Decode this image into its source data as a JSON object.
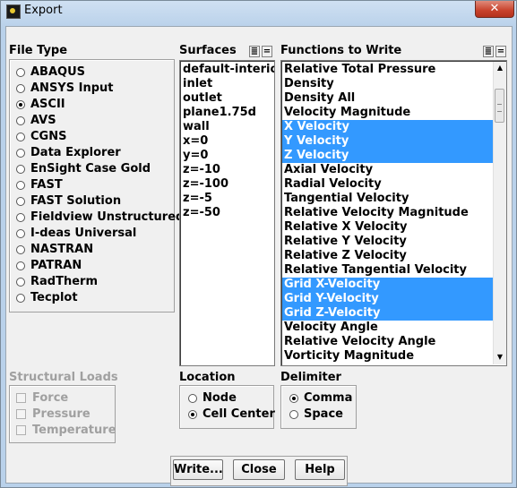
{
  "window": {
    "title": "Export",
    "close_glyph": "✕"
  },
  "file_type": {
    "label": "File Type",
    "options": [
      {
        "label": "ABAQUS",
        "selected": false
      },
      {
        "label": "ANSYS Input",
        "selected": false
      },
      {
        "label": "ASCII",
        "selected": true
      },
      {
        "label": "AVS",
        "selected": false
      },
      {
        "label": "CGNS",
        "selected": false
      },
      {
        "label": "Data Explorer",
        "selected": false
      },
      {
        "label": "EnSight Case Gold",
        "selected": false
      },
      {
        "label": "FAST",
        "selected": false
      },
      {
        "label": "FAST Solution",
        "selected": false
      },
      {
        "label": "Fieldview Unstructured",
        "selected": false
      },
      {
        "label": "I-deas Universal",
        "selected": false
      },
      {
        "label": "NASTRAN",
        "selected": false
      },
      {
        "label": "PATRAN",
        "selected": false
      },
      {
        "label": "RadTherm",
        "selected": false
      },
      {
        "label": "Tecplot",
        "selected": false
      }
    ]
  },
  "surfaces": {
    "label": "Surfaces",
    "items": [
      "default-interior",
      "inlet",
      "outlet",
      "plane1.75d",
      "wall",
      "x=0",
      "y=0",
      "z=-10",
      "z=-100",
      "z=-5",
      "z=-50"
    ]
  },
  "functions": {
    "label": "Functions to Write",
    "items": [
      {
        "label": "Relative Total Pressure",
        "selected": false
      },
      {
        "label": "Density",
        "selected": false
      },
      {
        "label": "Density All",
        "selected": false
      },
      {
        "label": "Velocity Magnitude",
        "selected": false
      },
      {
        "label": "X Velocity",
        "selected": true
      },
      {
        "label": "Y Velocity",
        "selected": true
      },
      {
        "label": "Z Velocity",
        "selected": true
      },
      {
        "label": "Axial Velocity",
        "selected": false
      },
      {
        "label": "Radial Velocity",
        "selected": false
      },
      {
        "label": "Tangential Velocity",
        "selected": false
      },
      {
        "label": "Relative Velocity Magnitude",
        "selected": false
      },
      {
        "label": "Relative X Velocity",
        "selected": false
      },
      {
        "label": "Relative Y Velocity",
        "selected": false
      },
      {
        "label": "Relative Z Velocity",
        "selected": false
      },
      {
        "label": "Relative Tangential Velocity",
        "selected": false
      },
      {
        "label": "Grid X-Velocity",
        "selected": true
      },
      {
        "label": "Grid Y-Velocity",
        "selected": true
      },
      {
        "label": "Grid Z-Velocity",
        "selected": true
      },
      {
        "label": "Velocity Angle",
        "selected": false
      },
      {
        "label": "Relative Velocity Angle",
        "selected": false
      },
      {
        "label": "Vorticity Magnitude",
        "selected": false
      }
    ]
  },
  "list_tool_icons": {
    "select_all": "≣",
    "deselect_all": "="
  },
  "structural_loads": {
    "label": "Structural Loads",
    "options": [
      "Force",
      "Pressure",
      "Temperature"
    ]
  },
  "location": {
    "label": "Location",
    "options": [
      {
        "label": "Node",
        "selected": false
      },
      {
        "label": "Cell Center",
        "selected": true
      }
    ]
  },
  "delimiter": {
    "label": "Delimiter",
    "options": [
      {
        "label": "Comma",
        "selected": true
      },
      {
        "label": "Space",
        "selected": false
      }
    ]
  },
  "buttons": {
    "write": "Write...",
    "close": "Close",
    "help": "Help"
  },
  "icons": {
    "app": "fluent-app-icon",
    "close": "close-icon",
    "select_all": "select-all-icon",
    "deselect_all": "deselect-all-icon",
    "scroll_up": "scroll-up-arrow-icon",
    "scroll_down": "scroll-down-arrow-icon"
  }
}
